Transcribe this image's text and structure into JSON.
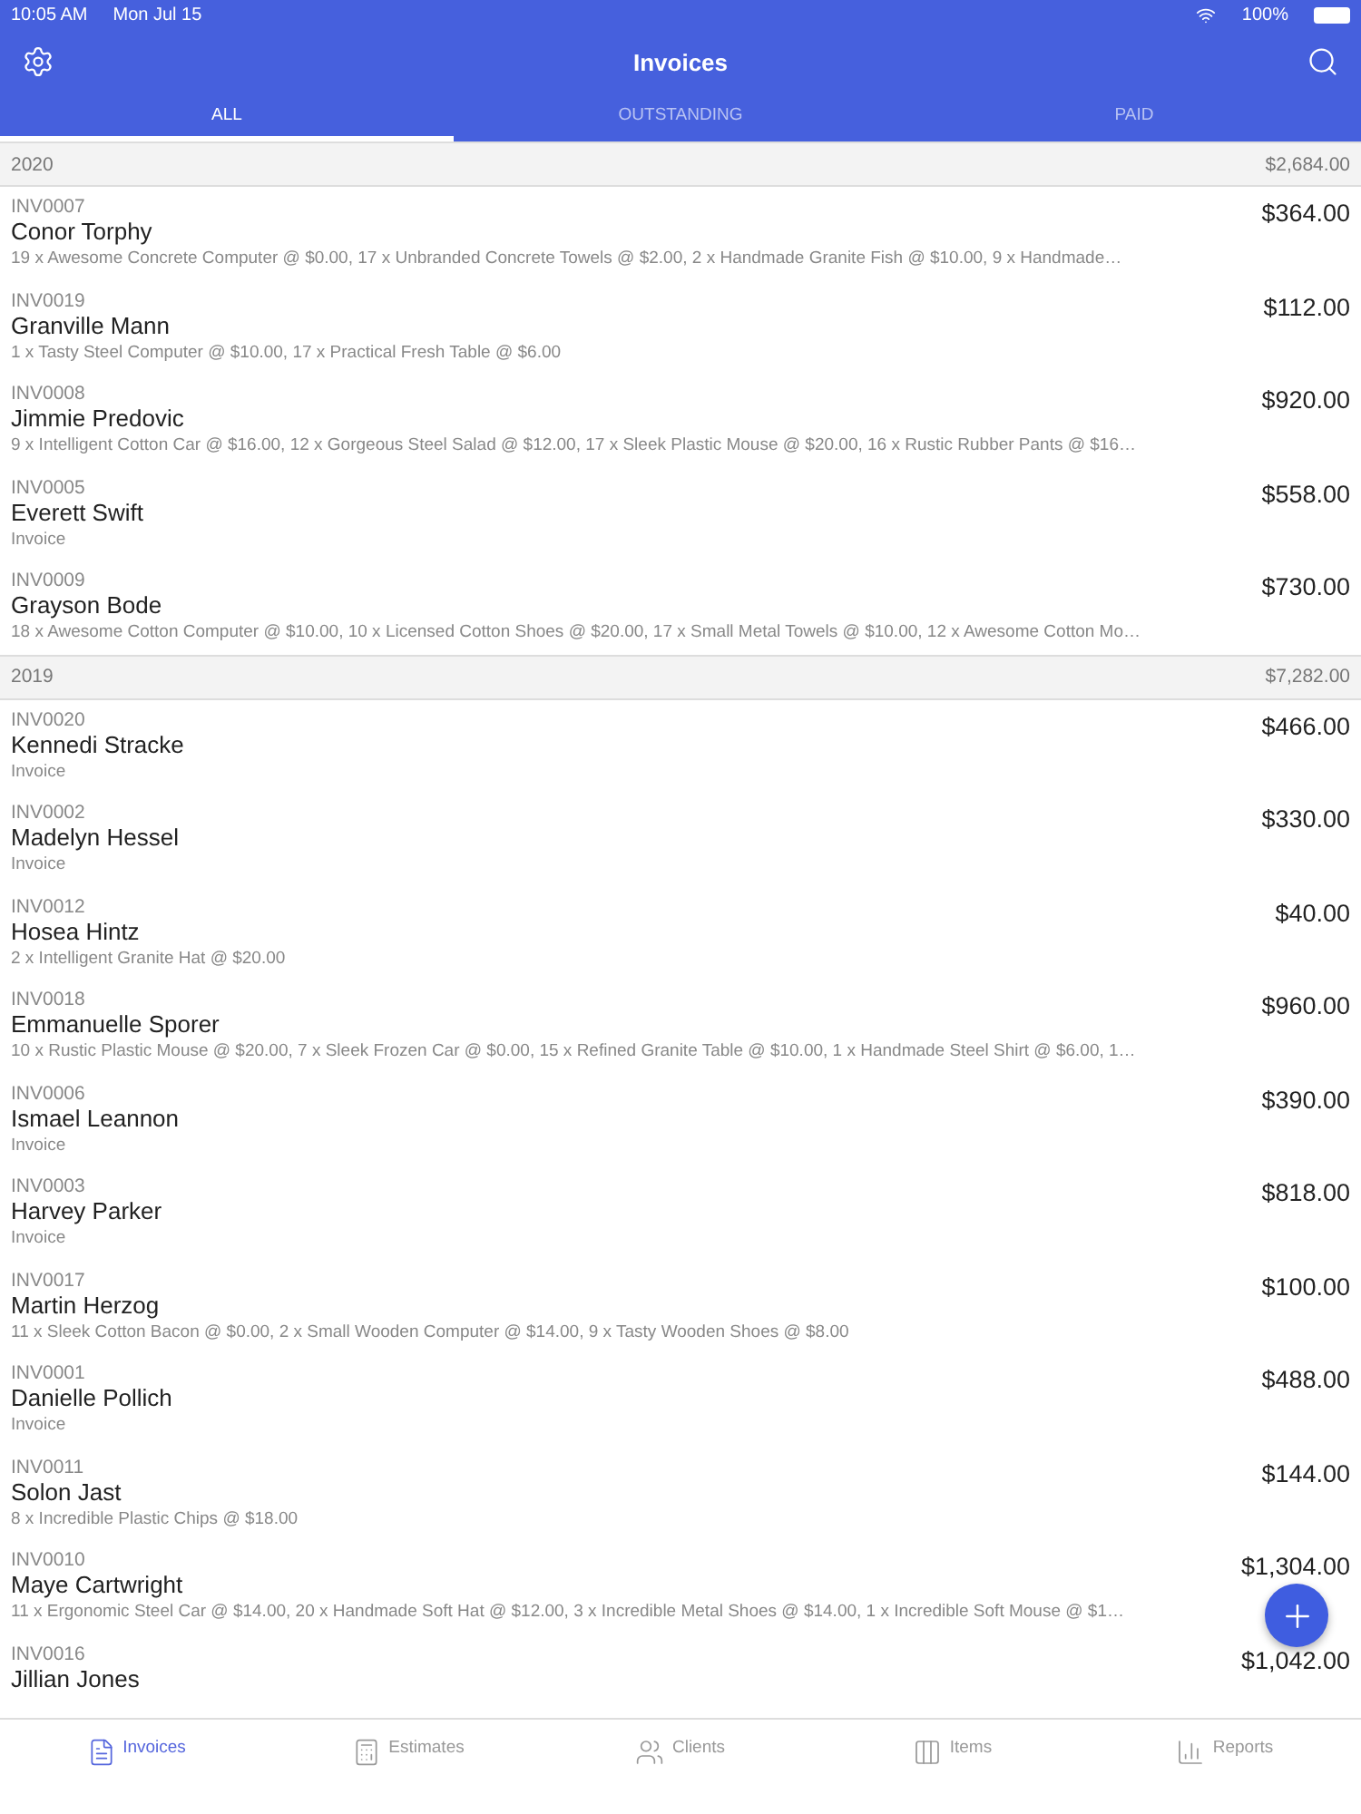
{
  "status_bar": {
    "time": "10:05 AM",
    "date": "Mon Jul 15",
    "battery": "100%"
  },
  "nav": {
    "title": "Invoices"
  },
  "tabs": [
    {
      "label": "ALL",
      "selected": true
    },
    {
      "label": "OUTSTANDING",
      "selected": false
    },
    {
      "label": "PAID",
      "selected": false
    }
  ],
  "sections": [
    {
      "year": "2020",
      "total": "$2,684.00",
      "invoices": [
        {
          "number": "INV0007",
          "client": "Conor Torphy",
          "amount": "$364.00",
          "description": "19 x Awesome Concrete Computer @ $0.00, 17 x Unbranded Concrete Towels @ $2.00, 2 x Handmade Granite Fish @ $10.00, 9 x Handmade…"
        },
        {
          "number": "INV0019",
          "client": "Granville Mann",
          "amount": "$112.00",
          "description": "1 x Tasty Steel Computer @ $10.00, 17 x Practical Fresh Table @ $6.00"
        },
        {
          "number": "INV0008",
          "client": "Jimmie Predovic",
          "amount": "$920.00",
          "description": "9 x Intelligent Cotton Car @ $16.00, 12 x Gorgeous Steel Salad @ $12.00, 17 x Sleek Plastic Mouse @ $20.00, 16 x Rustic Rubber Pants @ $16…"
        },
        {
          "number": "INV0005",
          "client": "Everett Swift",
          "amount": "$558.00",
          "description": "Invoice"
        },
        {
          "number": "INV0009",
          "client": "Grayson Bode",
          "amount": "$730.00",
          "description": "18 x Awesome Cotton Computer @ $10.00, 10 x Licensed Cotton Shoes @ $20.00, 17 x Small Metal Towels @ $10.00, 12 x Awesome Cotton Mo…"
        }
      ]
    },
    {
      "year": "2019",
      "total": "$7,282.00",
      "invoices": [
        {
          "number": "INV0020",
          "client": "Kennedi Stracke",
          "amount": "$466.00",
          "description": "Invoice"
        },
        {
          "number": "INV0002",
          "client": "Madelyn Hessel",
          "amount": "$330.00",
          "description": "Invoice"
        },
        {
          "number": "INV0012",
          "client": "Hosea Hintz",
          "amount": "$40.00",
          "description": "2 x Intelligent Granite Hat @ $20.00"
        },
        {
          "number": "INV0018",
          "client": "Emmanuelle Sporer",
          "amount": "$960.00",
          "description": "10 x Rustic Plastic Mouse @ $20.00, 7 x Sleek Frozen Car @ $0.00, 15 x Refined Granite Table @ $10.00, 1 x Handmade Steel Shirt @ $6.00, 1…"
        },
        {
          "number": "INV0006",
          "client": "Ismael Leannon",
          "amount": "$390.00",
          "description": "Invoice"
        },
        {
          "number": "INV0003",
          "client": "Harvey Parker",
          "amount": "$818.00",
          "description": "Invoice"
        },
        {
          "number": "INV0017",
          "client": "Martin Herzog",
          "amount": "$100.00",
          "description": "11 x Sleek Cotton Bacon @ $0.00, 2 x Small Wooden Computer @ $14.00, 9 x Tasty Wooden Shoes @ $8.00"
        },
        {
          "number": "INV0001",
          "client": "Danielle Pollich",
          "amount": "$488.00",
          "description": "Invoice"
        },
        {
          "number": "INV0011",
          "client": "Solon Jast",
          "amount": "$144.00",
          "description": "8 x Incredible Plastic Chips @ $18.00"
        },
        {
          "number": "INV0010",
          "client": "Maye Cartwright",
          "amount": "$1,304.00",
          "description": "11 x Ergonomic Steel Car @ $14.00, 20 x Handmade Soft Hat @ $12.00, 3 x Incredible Metal Shoes @ $14.00, 1 x Incredible Soft Mouse @ $1…"
        },
        {
          "number": "INV0016",
          "client": "Jillian Jones",
          "amount": "$1,042.00"
        }
      ]
    }
  ],
  "bottom_tabs": [
    {
      "label": "Invoices",
      "kind": "invoices",
      "selected": true
    },
    {
      "label": "Estimates",
      "kind": "estimates",
      "selected": false
    },
    {
      "label": "Clients",
      "kind": "clients",
      "selected": false
    },
    {
      "label": "Items",
      "kind": "items",
      "selected": false
    },
    {
      "label": "Reports",
      "kind": "reports",
      "selected": false
    }
  ]
}
